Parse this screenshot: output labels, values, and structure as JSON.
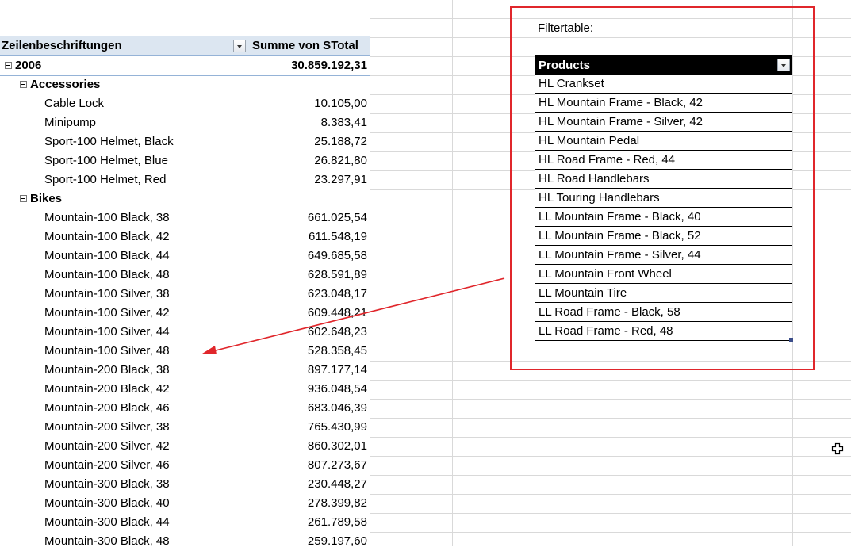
{
  "pivot": {
    "header": {
      "row_labels": "Zeilenbeschriftungen",
      "value_header": "Summe von STotal"
    },
    "year": {
      "label": "2006",
      "total": "30.859.192,31"
    },
    "categories": [
      {
        "label": "Accessories"
      },
      {
        "label": "Bikes"
      }
    ],
    "accessories": [
      {
        "label": "Cable Lock",
        "value": "10.105,00"
      },
      {
        "label": "Minipump",
        "value": "8.383,41"
      },
      {
        "label": "Sport-100 Helmet, Black",
        "value": "25.188,72"
      },
      {
        "label": "Sport-100 Helmet, Blue",
        "value": "26.821,80"
      },
      {
        "label": "Sport-100 Helmet, Red",
        "value": "23.297,91"
      }
    ],
    "bikes": [
      {
        "label": "Mountain-100 Black, 38",
        "value": "661.025,54"
      },
      {
        "label": "Mountain-100 Black, 42",
        "value": "611.548,19"
      },
      {
        "label": "Mountain-100 Black, 44",
        "value": "649.685,58"
      },
      {
        "label": "Mountain-100 Black, 48",
        "value": "628.591,89"
      },
      {
        "label": "Mountain-100 Silver, 38",
        "value": "623.048,17"
      },
      {
        "label": "Mountain-100 Silver, 42",
        "value": "609.448,21"
      },
      {
        "label": "Mountain-100 Silver, 44",
        "value": "602.648,23"
      },
      {
        "label": "Mountain-100 Silver, 48",
        "value": "528.358,45"
      },
      {
        "label": "Mountain-200 Black, 38",
        "value": "897.177,14"
      },
      {
        "label": "Mountain-200 Black, 42",
        "value": "936.048,54"
      },
      {
        "label": "Mountain-200 Black, 46",
        "value": "683.046,39"
      },
      {
        "label": "Mountain-200 Silver, 38",
        "value": "765.430,99"
      },
      {
        "label": "Mountain-200 Silver, 42",
        "value": "860.302,01"
      },
      {
        "label": "Mountain-200 Silver, 46",
        "value": "807.273,67"
      },
      {
        "label": "Mountain-300 Black, 38",
        "value": "230.448,27"
      },
      {
        "label": "Mountain-300 Black, 40",
        "value": "278.399,82"
      },
      {
        "label": "Mountain-300 Black, 44",
        "value": "261.789,58"
      },
      {
        "label": "Mountain-300 Black, 48",
        "value": "259.197,60"
      }
    ]
  },
  "filter": {
    "label": "Filtertable:",
    "header": "Products",
    "items": [
      "HL Crankset",
      "HL Mountain Frame - Black, 42",
      "HL Mountain Frame - Silver, 42",
      "HL Mountain Pedal",
      "HL Road Frame - Red, 44",
      "HL Road Handlebars",
      "HL Touring Handlebars",
      "LL Mountain Frame - Black, 40",
      "LL Mountain Frame - Black, 52",
      "LL Mountain Frame - Silver, 44",
      "LL Mountain Front Wheel",
      "LL Mountain Tire",
      "LL Road Frame - Black, 58",
      "LL Road Frame - Red, 48"
    ]
  },
  "icons": {
    "dropdown": "chevron-down-icon",
    "collapse": "collapse-minus-icon",
    "cursor": "cell-cursor-icon",
    "arrow": "annotation-arrow"
  },
  "colors": {
    "annotation": "#e0262b",
    "pivot_header": "#dce6f1",
    "table_header": "#000000"
  }
}
